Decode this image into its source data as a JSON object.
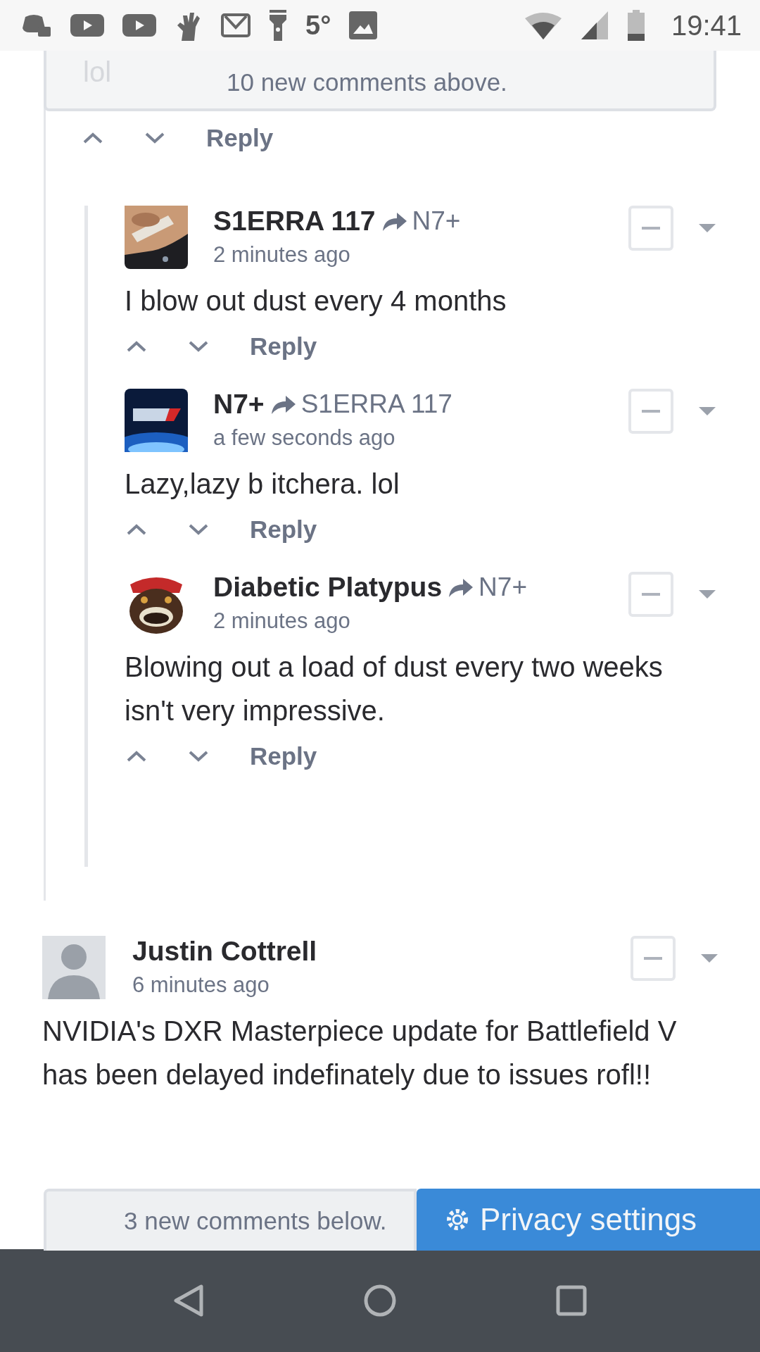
{
  "status_bar": {
    "temperature": "5°",
    "time": "19:41"
  },
  "top_notice": {
    "hidden_text": "lol",
    "label": "10 new comments above."
  },
  "parent_actions": {
    "reply": "Reply"
  },
  "replies": [
    {
      "author": "S1ERRA 117",
      "reply_to": "N7+",
      "time": "2 minutes ago",
      "body": "I blow out dust every 4 months",
      "reply": "Reply"
    },
    {
      "author": "N7+",
      "reply_to": "S1ERRA 117",
      "time": "a few seconds ago",
      "body": "Lazy,lazy b itchera. lol",
      "reply": "Reply"
    },
    {
      "author": "Diabetic Platypus",
      "reply_to": "N7+",
      "time": "2 minutes ago",
      "body": "Blowing out a load of dust every two weeks isn't very impressive.",
      "reply": "Reply"
    }
  ],
  "comment": {
    "author": "Justin Cottrell",
    "time": "6 minutes ago",
    "body": "NVIDIA's DXR Masterpiece update for Battlefield V has been delayed indefinately due to issues rofl!!",
    "avatar": {
      "kind": "default"
    }
  },
  "bottom": {
    "privacy_button": "Privacy settings",
    "notice": "3 new comments below."
  }
}
